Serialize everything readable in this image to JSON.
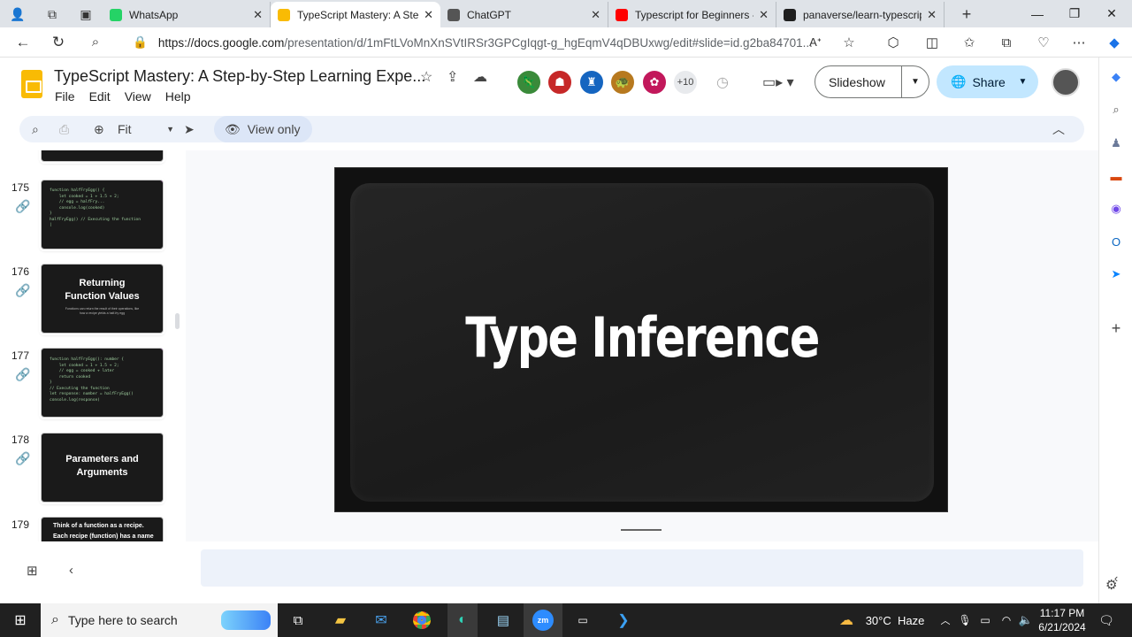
{
  "browser": {
    "tabs": [
      {
        "label": "WhatsApp",
        "icon": "whatsapp-icon",
        "color": "#25d366"
      },
      {
        "label": "TypeScript Mastery: A Step",
        "icon": "slides-icon",
        "color": "#f9bb04",
        "active": true
      },
      {
        "label": "ChatGPT",
        "icon": "chatgpt-icon",
        "color": "#555555"
      },
      {
        "label": "Typescript for Beginners -",
        "icon": "youtube-icon",
        "color": "#ff0000"
      },
      {
        "label": "panaverse/learn-typescrip",
        "icon": "github-icon",
        "color": "#1f1f1f"
      }
    ],
    "url_host": "https://docs.google.com",
    "url_path": "/presentation/d/1mFtLVoMnXnSVtIRSr3GPCgIqgt-g_hgEqmV4qDBUxwg/edit#slide=id.g2ba84701..."
  },
  "doc": {
    "title": "TypeScript Mastery: A Step-by-Step Learning Expe...",
    "menu": [
      "File",
      "Edit",
      "View",
      "Help"
    ],
    "collaborator_overflow": "+10",
    "slideshow_label": "Slideshow",
    "share_label": "Share"
  },
  "toolbar": {
    "zoom_label": "Fit",
    "view_only_label": "View only"
  },
  "filmstrip": {
    "slides": [
      {
        "number": "175",
        "kind": "code",
        "code": "function halfFryEgg() {\n    let cooked = 1 + 1.5 + 2;\n    // egg = halfFry...\n    console.log(cooked)\n}\nhalfFryEgg() // Executing the function\n|"
      },
      {
        "number": "176",
        "kind": "title",
        "title": "Returning Function Values",
        "subtitle": "Functions can return the result of their operations, like how a recipe yields a half-fry egg"
      },
      {
        "number": "177",
        "kind": "code",
        "code": "function halfFryEgg(): number {\n    let cooked = 1 + 1.5 + 2;\n    // egg = cooked + later\n    return cooked\n}\n// Executing the function\nlet response: number = halfFryEgg()\nconsole.log(response)"
      },
      {
        "number": "178",
        "kind": "title",
        "title": "Parameters and Arguments",
        "subtitle": ""
      },
      {
        "number": "179",
        "kind": "bullets",
        "bullets": [
          "Think of a function as a recipe.",
          "Each recipe (function) has a name"
        ]
      }
    ]
  },
  "current_slide": {
    "title": "Type Inference"
  },
  "taskbar": {
    "search_placeholder": "Type here to search",
    "weather": "30°C  Haze",
    "time": "11:17 PM",
    "date": "6/21/2024"
  }
}
